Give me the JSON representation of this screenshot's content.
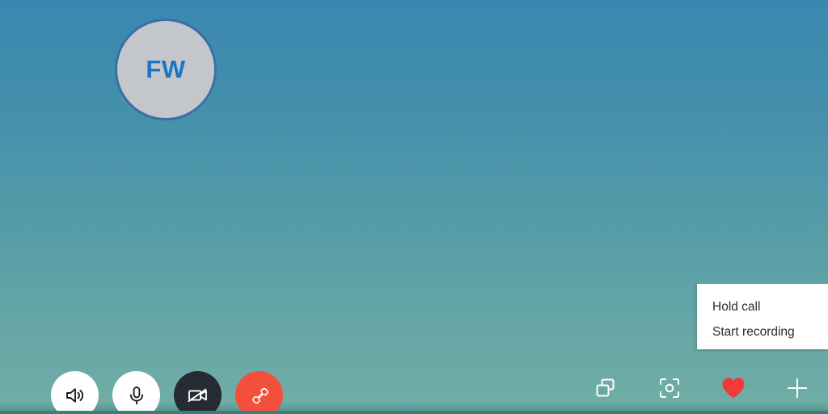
{
  "call_screen": {
    "background": {
      "gradient_top": "#3a87b0",
      "gradient_mid": "#539aa8",
      "gradient_bottom": "#6fada6",
      "bottom_strip": "#3d7d7c"
    },
    "participant": {
      "initials": "FW",
      "avatar_fill": "#c3c7cb",
      "avatar_border": "#3a6fa5",
      "initials_color": "#1a76c4"
    },
    "context_menu": {
      "items": [
        {
          "label": "Hold call"
        },
        {
          "label": "Start recording"
        }
      ]
    },
    "controls": [
      {
        "name": "speaker",
        "icon": "speaker-icon",
        "style": "white"
      },
      {
        "name": "microphone",
        "icon": "microphone-icon",
        "style": "white"
      },
      {
        "name": "camera-off",
        "icon": "camera-off-icon",
        "style": "dark"
      },
      {
        "name": "end-call",
        "icon": "end-call-icon",
        "style": "red"
      }
    ],
    "actions": [
      {
        "name": "screen-share",
        "icon": "screen-share-icon",
        "color": "#ffffff"
      },
      {
        "name": "snapshot",
        "icon": "snapshot-icon",
        "color": "#ffffff"
      },
      {
        "name": "reaction-heart",
        "icon": "heart-icon",
        "color": "#f23b38"
      },
      {
        "name": "add-people",
        "icon": "plus-icon",
        "color": "#ffffff"
      }
    ]
  }
}
